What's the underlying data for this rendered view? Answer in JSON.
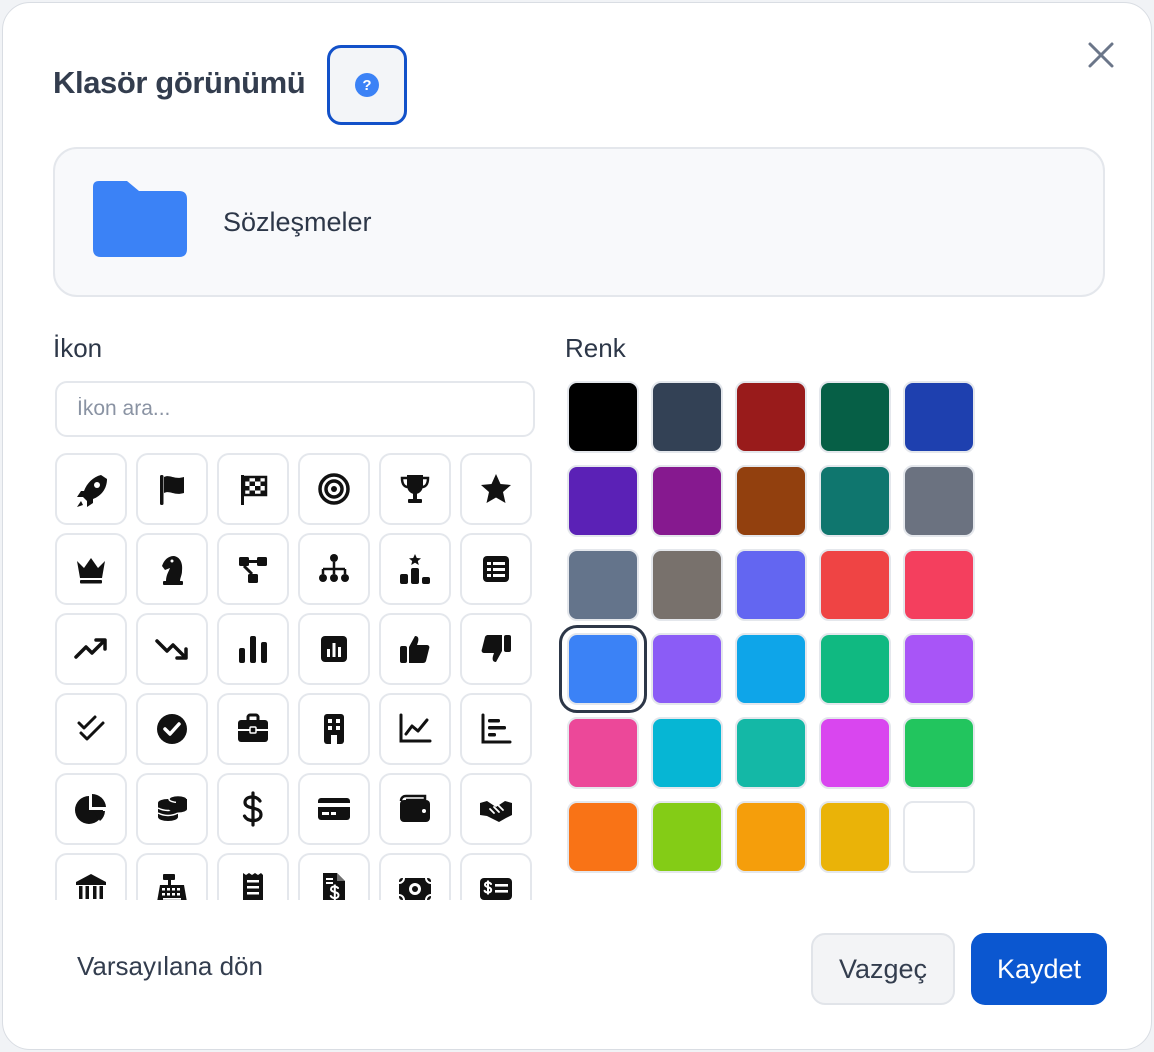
{
  "dialog": {
    "title": "Klasör görünümü",
    "help_label": "?",
    "close_icon": "close-icon"
  },
  "preview": {
    "folder_color": "#3b82f6",
    "folder_name": "Sözleşmeler"
  },
  "icon_section": {
    "label": "İkon",
    "search_placeholder": "İkon ara...",
    "icons": [
      "rocket-icon",
      "flag-icon",
      "checkered-flag-icon",
      "target-icon",
      "trophy-icon",
      "star-icon",
      "crown-icon",
      "chess-knight-icon",
      "workflow-icon",
      "org-chart-icon",
      "ranking-icon",
      "table-icon",
      "trending-up-icon",
      "trending-down-icon",
      "bar-chart-icon",
      "chart-square-icon",
      "thumbs-up-icon",
      "thumbs-down-icon",
      "double-check-icon",
      "check-circle-icon",
      "briefcase-icon",
      "building-icon",
      "line-chart-icon",
      "bar-chart-horizontal-icon",
      "pie-chart-icon",
      "coins-icon",
      "dollar-icon",
      "credit-card-icon",
      "wallet-icon",
      "handshake-icon",
      "bank-icon",
      "cash-register-icon",
      "receipt-icon",
      "invoice-dollar-icon",
      "money-bill-icon",
      "money-check-icon"
    ]
  },
  "color_section": {
    "label": "Renk",
    "colors": [
      "#000000",
      "#334155",
      "#991b1b",
      "#065f46",
      "#1e40af",
      "#5b21b6",
      "#86198f",
      "#92400e",
      "#0f766e",
      "#6b7280",
      "#64748b",
      "#78716c",
      "#6366f1",
      "#ef4444",
      "#f43f5e",
      "#3b82f6",
      "#8b5cf6",
      "#0ea5e9",
      "#10b981",
      "#a855f7",
      "#ec4899",
      "#06b6d4",
      "#14b8a6",
      "#d946ef",
      "#22c55e",
      "#f97316",
      "#84cc16",
      "#f59e0b",
      "#eab308",
      "#ffffff"
    ],
    "selected_color": "#3b82f6"
  },
  "footer": {
    "reset_label": "Varsayılana dön",
    "cancel_label": "Vazgeç",
    "save_label": "Kaydet"
  }
}
